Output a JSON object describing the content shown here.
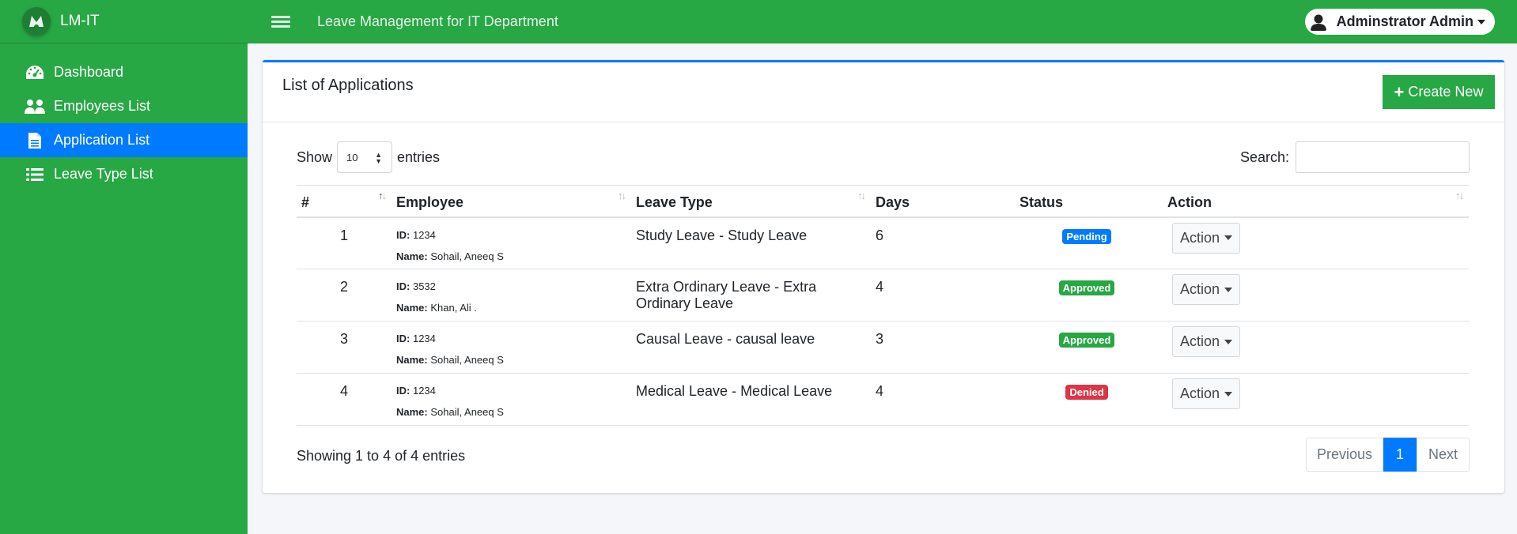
{
  "brand": {
    "name": "LM-IT"
  },
  "sidebar": {
    "items": [
      {
        "label": "Dashboard",
        "icon": "dashboard-gauge-icon"
      },
      {
        "label": "Employees List",
        "icon": "users-icon"
      },
      {
        "label": "Application List",
        "icon": "file-icon",
        "active": true
      },
      {
        "label": "Leave Type List",
        "icon": "list-icon"
      }
    ]
  },
  "topbar": {
    "title": "Leave Management for IT Department",
    "user": "Adminstrator Admin"
  },
  "card": {
    "title": "List of Applications",
    "create_label": "Create New"
  },
  "table_controls": {
    "show_label": "Show",
    "page_length": "10",
    "entries_label": "entries",
    "search_label": "Search:",
    "search_value": ""
  },
  "table": {
    "headers": [
      "#",
      "Employee",
      "Leave Type",
      "Days",
      "Status",
      "Action"
    ],
    "id_label": "ID:",
    "name_label": "Name:",
    "rows": [
      {
        "num": "1",
        "id": "1234",
        "name": "Sohail, Aneeq S",
        "leave_type": "Study Leave - Study Leave",
        "days": "6",
        "status": "Pending",
        "action": "Action"
      },
      {
        "num": "2",
        "id": "3532",
        "name": "Khan, Ali .",
        "leave_type": "Extra Ordinary Leave - Extra Ordinary Leave",
        "days": "4",
        "status": "Approved",
        "action": "Action"
      },
      {
        "num": "3",
        "id": "1234",
        "name": "Sohail, Aneeq S",
        "leave_type": "Causal Leave - causal leave",
        "days": "3",
        "status": "Approved",
        "action": "Action"
      },
      {
        "num": "4",
        "id": "1234",
        "name": "Sohail, Aneeq S",
        "leave_type": "Medical Leave - Medical Leave",
        "days": "4",
        "status": "Denied",
        "action": "Action"
      }
    ]
  },
  "footer": {
    "info": "Showing 1 to 4 of 4 entries",
    "prev": "Previous",
    "current_page": "1",
    "next": "Next"
  },
  "colors": {
    "primary_green": "#28a745",
    "accent_blue": "#007bff",
    "danger_red": "#dc3545"
  }
}
